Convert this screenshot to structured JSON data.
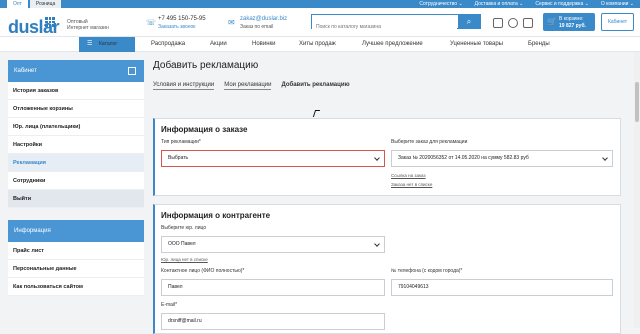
{
  "topbar": {
    "tabs": [
      "Опт",
      "Розница"
    ],
    "menu": [
      "Сотрудничество ⌄",
      "Доставка и оплата ⌄",
      "Сервис и поддержка ⌄",
      "О компании ⌄"
    ]
  },
  "header": {
    "logo": "duslar",
    "tagline_1": "Оптовый",
    "tagline_2": "Интернет магазин",
    "phone": "+7 495 150-75-95",
    "callback": "Заказать звонок",
    "email": "zakaz@duslar.biz",
    "email_caption": "Заказ по email",
    "search_placeholder": "Поиск по каталогу магазина",
    "cart_line1": "В корзине:",
    "cart_line2": "19 827 руб.",
    "cabinet": "Кабинет"
  },
  "nav": {
    "catalog": "Каталог",
    "items": [
      "Распродажа",
      "Акции",
      "Новинки",
      "Хиты продаж",
      "Лучшее предложение",
      "Уцененные товары",
      "Бренды"
    ]
  },
  "sidebar": {
    "cabinet_title": "Кабинет",
    "items": [
      "История заказов",
      "Отложенные корзины",
      "Юр. лица (плательщики)",
      "Настройки",
      "Рекламация",
      "Сотрудники",
      "Выйти"
    ],
    "info_title": "Информация",
    "info_items": [
      "Прайс лист",
      "Персональные данные",
      "Как пользоваться сайтом"
    ]
  },
  "main": {
    "title": "Добавить рекламацию",
    "subtabs": [
      "Условия и инструкции",
      "Мои рекламации",
      "Добавить рекламацию"
    ],
    "order_card": {
      "title": "Информация о заказе",
      "type_label": "Тип рекламации*",
      "type_value": "Выбрать",
      "order_label": "Выберите заказ для рекламации",
      "order_value": "Заказ № 2020056352 от 14.05.2020 на сумму 582.83 руб",
      "link1": "Ссылка на заказ",
      "link2": "Заказа нет в списке"
    },
    "contractor_card": {
      "title": "Информация о контрагенте",
      "entity_label": "Выберите юр. лицо",
      "entity_value": "ООО Павел",
      "entity_link": "Юр. лица нет в списке",
      "contact_label": "Контактное лицо (ФИО полностью)*",
      "contact_value": "Павел",
      "phone_label": "№ телефона (с кодом города)*",
      "phone_value": "79104049613",
      "email_label": "E-mail*",
      "email_value": "drsniff@mail.ru"
    }
  },
  "colors": {
    "accent": "#3a89c9",
    "error": "#d9534f"
  }
}
